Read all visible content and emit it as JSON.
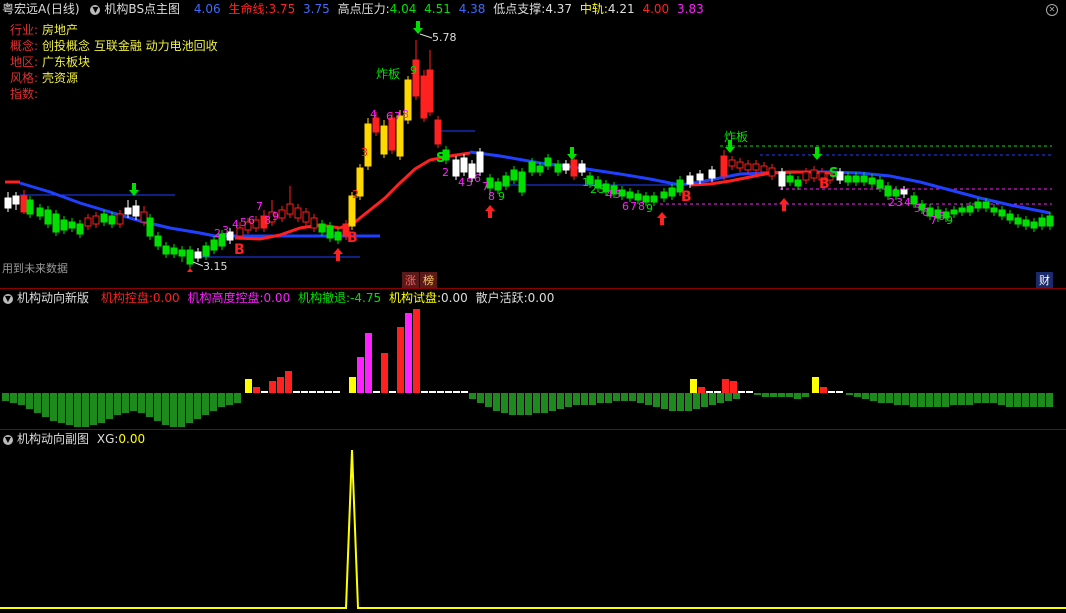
{
  "main": {
    "stock_name": "粤宏远A",
    "period": "(日线)",
    "indicator_name": "机构BS点主图",
    "val_a": "4.06",
    "life_line_label": "生命线:",
    "life_line_val": "3.75",
    "val_b": "3.75",
    "high_pressure_label": "高点压力:",
    "high_pressure_val": "4.04",
    "val_c": "4.51",
    "val_d": "4.38",
    "low_support_label": "低点支撑:",
    "low_support_val": "4.37",
    "mid_track_label": "中轨:",
    "mid_track_val": "4.21",
    "val_e": "4.00",
    "val_f": "3.83",
    "info": [
      {
        "key": "行业:",
        "value": "房地产"
      },
      {
        "key": "概念:",
        "value": "创投概念 互联金融 动力电池回收"
      },
      {
        "key": "地区:",
        "value": "广东板块"
      },
      {
        "key": "风格:",
        "value": "壳资源"
      },
      {
        "key": "指数:",
        "value": ""
      }
    ],
    "future_data_note": "用到未来数据",
    "zhang": "涨",
    "bang": "榜",
    "cai": "财",
    "high_price": "5.78",
    "low_price": "3.15",
    "zhaban": "炸板"
  },
  "panel2": {
    "title": "机构动向新版",
    "ctrl_label": "机构控盘:",
    "ctrl_val": "0.00",
    "high_ctrl_label": "机构高度控盘:",
    "high_ctrl_val": "0.00",
    "retreat_label": "机构撤退:",
    "retreat_val": "-4.75",
    "test_label": "机构试盘:",
    "test_val": "0.00",
    "retail_label": "散户活跃:",
    "retail_val": "0.00"
  },
  "panel3": {
    "title": "机构动向副图",
    "xg_label": "XG:",
    "xg_val": "0.00"
  },
  "colors": {
    "red": "#ff2020",
    "green": "#00e000",
    "blue": "#2040ff",
    "yellow": "#ffff00",
    "magenta": "#ff20ff",
    "dark_green": "#1e8a1e",
    "cyan": "#40c0ff"
  }
}
